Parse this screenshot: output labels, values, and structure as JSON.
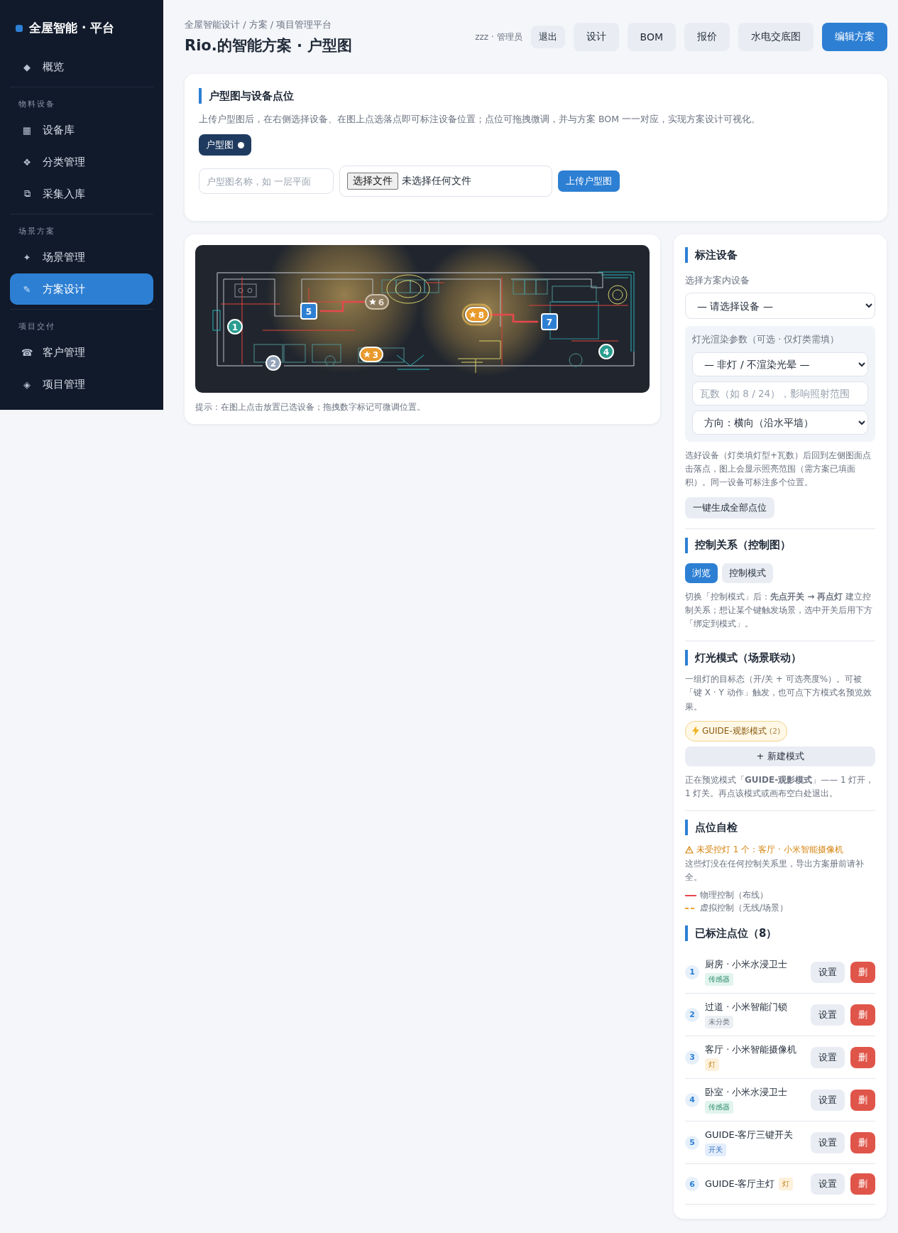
{
  "sidebar": {
    "brand": "全屋智能 · 平台",
    "groups": [
      {
        "items": [
          {
            "icon": "◆",
            "label": "概览",
            "selected": false
          }
        ]
      },
      {
        "label": "物料设备",
        "items": [
          {
            "icon": "▦",
            "label": "设备库",
            "selected": false
          },
          {
            "icon": "❖",
            "label": "分类管理",
            "selected": false
          },
          {
            "icon": "⧉",
            "label": "采集入库",
            "selected": false
          }
        ]
      },
      {
        "label": "场景方案",
        "items": [
          {
            "icon": "✦",
            "label": "场景管理",
            "selected": false
          },
          {
            "icon": "✎",
            "label": "方案设计",
            "selected": true
          }
        ]
      },
      {
        "label": "项目交付",
        "items": [
          {
            "icon": "☎",
            "label": "客户管理",
            "selected": false
          },
          {
            "icon": "◈",
            "label": "项目管理",
            "selected": false
          }
        ]
      }
    ]
  },
  "header": {
    "breadcrumb": "全屋智能设计 / 方案 / 项目管理平台",
    "title": "Rio.的智能方案 · 户型图",
    "user": "zzz · 管理员",
    "logout": "退出",
    "buttons": [
      {
        "label": "设计",
        "kind": "secondary"
      },
      {
        "label": "BOM",
        "kind": "secondary"
      },
      {
        "label": "报价",
        "kind": "secondary"
      },
      {
        "label": "水电交底图",
        "kind": "secondary"
      },
      {
        "label": "编辑方案",
        "kind": "primary"
      }
    ]
  },
  "upload_card": {
    "title": "户型图与设备点位",
    "description": "上传户型图后，在右侧选择设备、在图上点选落点即可标注设备位置；点位可拖拽微调，并与方案 BOM 一一对应，实现方案设计可视化。",
    "plans": [
      {
        "label": "户型图",
        "selected": true
      }
    ],
    "name_field": {
      "placeholder": "户型图名称，如 一层平面"
    },
    "file_button": "选择文件",
    "file_status": "未选择任何文件",
    "upload_button": "上传户型图"
  },
  "floor_plan": {
    "markers": [
      {
        "label": "1",
        "kind": "sensor",
        "color": "#2a9d8f",
        "glowing": false,
        "dimmed": false,
        "wired": false
      },
      {
        "label": "2",
        "kind": "other",
        "color": "#94a3b8",
        "glowing": false,
        "dimmed": false,
        "wired": false
      },
      {
        "label": "3",
        "kind": "light",
        "color": "#e89a2c",
        "glowing": false,
        "dimmed": false,
        "wired": false
      },
      {
        "label": "4",
        "kind": "sensor",
        "color": "#2a9d8f",
        "glowing": false,
        "dimmed": false,
        "wired": false
      },
      {
        "label": "5",
        "kind": "switch",
        "color": "#2d7fd3",
        "glowing": false,
        "dimmed": false,
        "wired": true
      },
      {
        "label": "6",
        "kind": "light",
        "color": "#8c7a5e",
        "glowing": false,
        "dimmed": true,
        "wired": false
      },
      {
        "label": "7",
        "kind": "switch",
        "color": "#2d7fd3",
        "glowing": false,
        "dimmed": false,
        "wired": false
      },
      {
        "label": "8",
        "kind": "light",
        "color": "#e89a2c",
        "glowing": true,
        "dimmed": false,
        "wired": true
      }
    ],
    "hint": "提示：在图上点击放置已选设备；拖拽数字标记可微调位置。"
  },
  "panel": {
    "mark": {
      "title": "标注设备",
      "select_label": "选择方案内设备",
      "device_select": "— 请选择设备 —",
      "light_params": {
        "title": "灯光渲染参数（可选 · 仅灯类需填）",
        "type_select": "— 非灯 / 不渲染光晕 —",
        "watt_field": {
          "placeholder": "瓦数（如 8 / 24），影响照射范围"
        },
        "direction_select": "方向：横向（沿水平墙）"
      },
      "note": "选好设备（灯类填灯型+瓦数）后回到左侧图面点击落点，图上会显示照亮范围（需方案已填面积）。同一设备可标注多个位置。",
      "generate_button": "一键生成全部点位"
    },
    "control": {
      "title": "控制关系（控制图）",
      "tabs": [
        {
          "label": "浏览",
          "selected": true
        },
        {
          "label": "控制模式",
          "selected": false
        }
      ],
      "note": "切换「控制模式」后：**先点开关 → 再点灯** 建立控制关系；想让某个键触发场景，选中开关后用下方「绑定到模式」。"
    },
    "modes": {
      "title": "灯光模式（场景联动）",
      "note": "一组灯的目标态（开/关 + 可选亮度%）。可被「键 X · Y 动作」触发，也可点下方模式名预览效果。",
      "items": [
        {
          "name": "GUIDE-观影模式",
          "count": "(2)",
          "selected": true
        }
      ],
      "new_button": "+ 新建模式",
      "preview_note": "正在预览模式「**GUIDE-观影模式**」—— 1 灯开，1 灯关。再点该模式或画布空白处退出。"
    },
    "check": {
      "title": "点位自检",
      "warning": "未受控灯 1 个：客厅 · 小米智能摄像机",
      "note": "这些灯没在任何控制关系里，导出方案册前请补全。",
      "legend": [
        {
          "label": "物理控制（布线）",
          "kind": "solid"
        },
        {
          "label": "虚拟控制（无线/场景）",
          "kind": "dashed"
        }
      ]
    },
    "points": {
      "title": "已标注点位（8）",
      "items": [
        {
          "number": "1",
          "name": "厨房 · 小米水浸卫士",
          "tag": "传感器",
          "kind": "sensor",
          "settings_button": "设置",
          "delete_button": "删"
        },
        {
          "number": "2",
          "name": "过道 · 小米智能门锁",
          "tag": "未分类",
          "kind": "other",
          "settings_button": "设置",
          "delete_button": "删"
        },
        {
          "number": "3",
          "name": "客厅 · 小米智能摄像机",
          "tag": "灯",
          "kind": "light",
          "settings_button": "设置",
          "delete_button": "删"
        },
        {
          "number": "4",
          "name": "卧室 · 小米水浸卫士",
          "tag": "传感器",
          "kind": "sensor",
          "settings_button": "设置",
          "delete_button": "删"
        },
        {
          "number": "5",
          "name": "GUIDE-客厅三键开关",
          "tag": "开关",
          "kind": "switch",
          "settings_button": "设置",
          "delete_button": "删"
        },
        {
          "number": "6",
          "name": "GUIDE-客厅主灯",
          "tag": "灯",
          "kind": "light",
          "settings_button": "设置",
          "delete_button": "删"
        }
      ]
    }
  }
}
